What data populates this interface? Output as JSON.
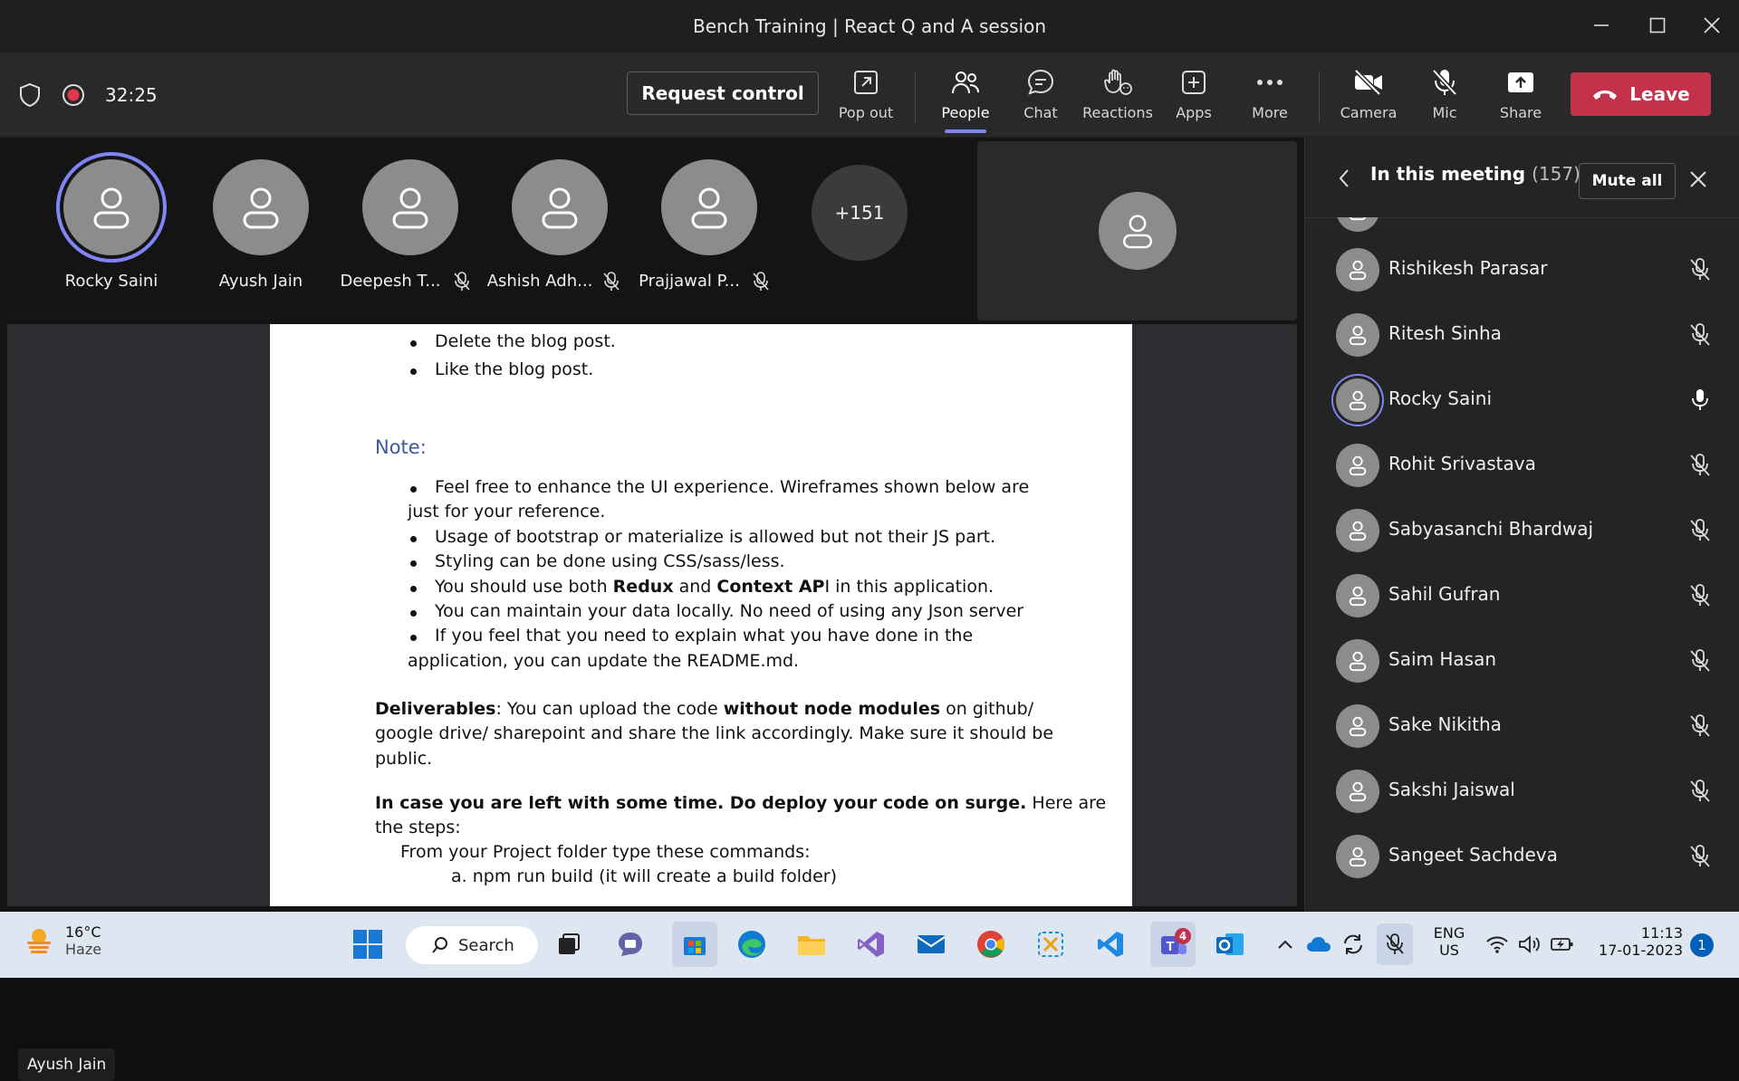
{
  "window": {
    "title": "Bench Training | React Q and A session"
  },
  "toolbar": {
    "timer": "32:25",
    "request_control": "Request control",
    "pop_out": "Pop out",
    "people": "People",
    "chat": "Chat",
    "reactions": "Reactions",
    "apps": "Apps",
    "more": "More",
    "camera": "Camera",
    "mic": "Mic",
    "share": "Share",
    "leave": "Leave"
  },
  "gallery": {
    "tiles": [
      {
        "name": "Rocky Saini",
        "speaking": true,
        "muted": false
      },
      {
        "name": "Ayush Jain",
        "speaking": false,
        "muted": false
      },
      {
        "name": "Deepesh T...",
        "speaking": false,
        "muted": true
      },
      {
        "name": "Ashish Adh...",
        "speaking": false,
        "muted": true
      },
      {
        "name": "Prajjawal P...",
        "speaking": false,
        "muted": true
      }
    ],
    "overflow_count": "+151"
  },
  "share": {
    "presenter": "Ayush Jain",
    "doc": {
      "b1": "Delete the blog post.",
      "b2": "Like the blog post.",
      "note_heading": "Note:",
      "n1a": "Feel free to enhance the UI experience. Wireframes shown below are",
      "n1b": "just for your reference.",
      "n2": "Usage of bootstrap or materialize is allowed but not their JS part.",
      "n3": "Styling can be done using CSS/sass/less.",
      "n4_pre": "You should use both ",
      "n4_redux": "Redux",
      "n4_and": " and ",
      "n4_ctx": "Context AP",
      "n4_post": "I in this application.",
      "n5": "You can maintain your data locally. No need of using any Json server",
      "n6a": "If you feel that you need to explain what you have done in the",
      "n6b": "application, you can update the README.md.",
      "d_label": "Deliverables",
      "d1_mid": ": You can upload the code ",
      "d1_bold": "without node modules",
      "d1_post": " on github/",
      "d2": "google drive/ sharepoint and share the link accordingly. Make sure it should be",
      "d3": "public.",
      "c1_bold": "In case you are left with some time. Do deploy your code on surge.",
      "c1_post": " Here are",
      "c2": "the steps:",
      "c3": "From your Project folder type these commands:",
      "c4": "a.   npm run build (it will create a build folder)"
    }
  },
  "panel": {
    "title": "In this meeting",
    "count": "(157)",
    "mute_all": "Mute all",
    "participants": [
      {
        "name": "Rishikesh Parasar",
        "muted": true,
        "speaking": false
      },
      {
        "name": "Ritesh Sinha",
        "muted": true,
        "speaking": false
      },
      {
        "name": "Rocky Saini",
        "muted": false,
        "speaking": true
      },
      {
        "name": "Rohit Srivastava",
        "muted": true,
        "speaking": false
      },
      {
        "name": "Sabyasanchi Bhardwaj",
        "muted": true,
        "speaking": false
      },
      {
        "name": "Sahil Gufran",
        "muted": true,
        "speaking": false
      },
      {
        "name": "Saim Hasan",
        "muted": true,
        "speaking": false
      },
      {
        "name": "Sake Nikitha",
        "muted": true,
        "speaking": false
      },
      {
        "name": "Sakshi Jaiswal",
        "muted": true,
        "speaking": false
      },
      {
        "name": "Sangeet Sachdeva",
        "muted": true,
        "speaking": false
      }
    ]
  },
  "taskbar": {
    "temp": "16°C",
    "weather": "Haze",
    "search": "Search",
    "lang1": "ENG",
    "lang2": "US",
    "time": "11:13",
    "date": "17-01-2023",
    "teams_badge": "4",
    "notif_count": "1"
  },
  "colors": {
    "accent": "#7f85f5",
    "leave": "#c4314b",
    "toolbar": "#292929",
    "stage": "#141414"
  }
}
